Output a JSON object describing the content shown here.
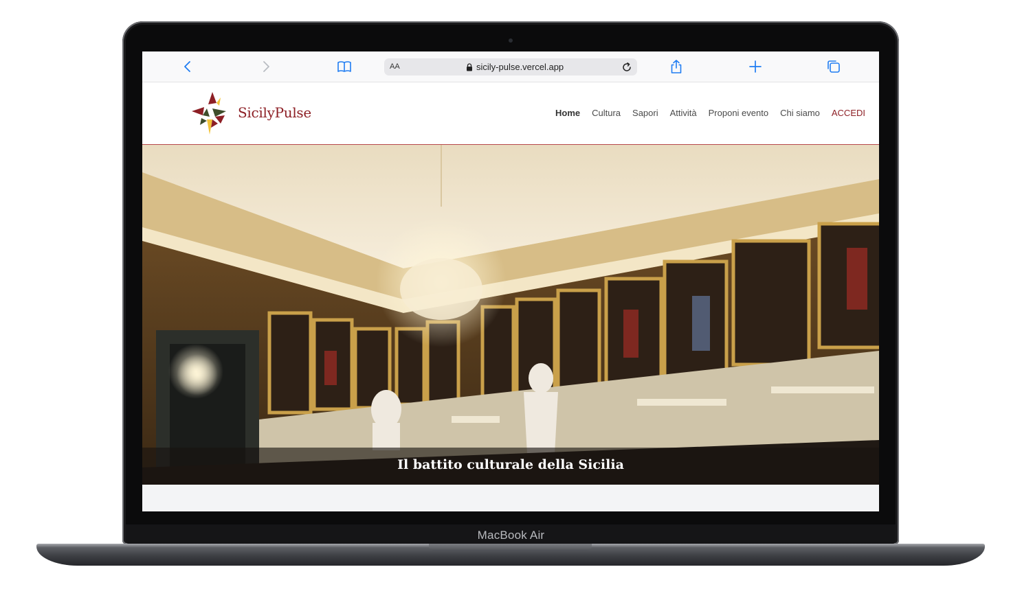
{
  "device": {
    "label": "MacBook Air"
  },
  "browser": {
    "text_size_label": "AA",
    "url": "sicily-pulse.vercel.app",
    "icons": [
      "back-icon",
      "forward-icon",
      "bookmarks-icon",
      "lock-icon",
      "reload-icon",
      "share-icon",
      "new-tab-icon",
      "tabs-icon"
    ]
  },
  "site": {
    "brand": "SicilyPulse",
    "nav": [
      {
        "label": "Home",
        "active": true
      },
      {
        "label": "Cultura"
      },
      {
        "label": "Sapori"
      },
      {
        "label": "Attività"
      },
      {
        "label": "Proponi evento"
      },
      {
        "label": "Chi siamo"
      },
      {
        "label": "ACCEDI"
      }
    ]
  },
  "hero": {
    "caption": "Il battito culturale della Sicilia",
    "image_alt": "Sala nobile con lampadario di cristallo, ritratti e statue"
  },
  "colors": {
    "brand": "#8d1f25",
    "safari_blue": "#1e7cf2",
    "logo_green": "#3e4d2a",
    "logo_gold": "#f2c43a"
  }
}
